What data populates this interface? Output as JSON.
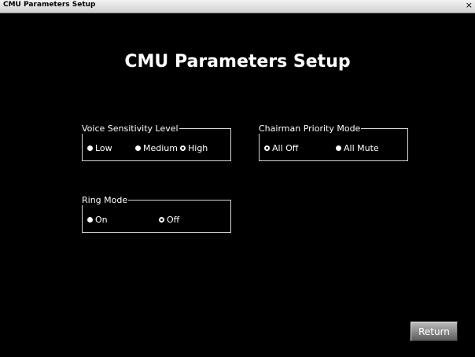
{
  "window": {
    "title": "CMU Parameters Setup",
    "close_glyph": "×"
  },
  "heading": "CMU Parameters Setup",
  "voice_sensitivity": {
    "legend": "Voice Sensitivity Level",
    "options": [
      {
        "label": "Low",
        "selected": false
      },
      {
        "label": "Medium",
        "selected": false
      },
      {
        "label": "High",
        "selected": true
      }
    ]
  },
  "chairman_priority": {
    "legend": "Chairman Priority Mode",
    "options": [
      {
        "label": "All Off",
        "selected": true
      },
      {
        "label": "All Mute",
        "selected": false
      }
    ]
  },
  "ring_mode": {
    "legend": "Ring Mode",
    "options": [
      {
        "label": "On",
        "selected": false
      },
      {
        "label": "Off",
        "selected": true
      }
    ]
  },
  "return_button": {
    "label": "Return"
  },
  "colors": {
    "background": "#000000",
    "text": "#ffffff",
    "titlebar": "#dcdcdc",
    "group_border": "#d6d6d6"
  }
}
